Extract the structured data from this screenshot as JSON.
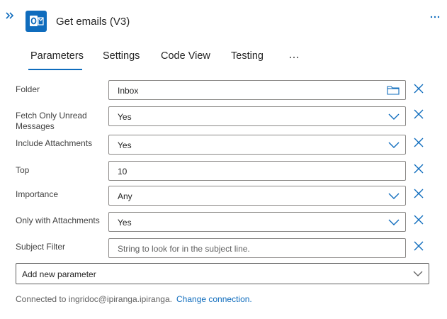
{
  "header": {
    "title": "Get emails (V3)",
    "collapse_icon": "double-chevron-right-icon",
    "action_icon": "outlook-icon",
    "more_icon": "more-horizontal-icon"
  },
  "tabs": [
    {
      "label": "Parameters",
      "selected": true
    },
    {
      "label": "Settings",
      "selected": false
    },
    {
      "label": "Code View",
      "selected": false
    },
    {
      "label": "Testing",
      "selected": false
    }
  ],
  "params": {
    "folder": {
      "label": "Folder",
      "value": "Inbox",
      "icon": "folder-icon"
    },
    "fetch_unread": {
      "label_line1": "Fetch Only Unread",
      "label_line2": "Messages",
      "value": "Yes"
    },
    "include_attachments": {
      "label": "Include Attachments",
      "value": "Yes"
    },
    "top": {
      "label": "Top",
      "value": "10"
    },
    "importance": {
      "label": "Importance",
      "value": "Any"
    },
    "only_with_attachments": {
      "label": "Only with Attachments",
      "value": "Yes"
    },
    "subject_filter": {
      "label": "Subject Filter",
      "placeholder": "String to look for in the subject line."
    }
  },
  "add_parameter": {
    "label": "Add new parameter"
  },
  "footer": {
    "connected_text": "Connected to ingridoc@ipiranga.ipiranga.",
    "change_link": "Change connection."
  },
  "colors": {
    "accent": "#0f6cbd",
    "border": "#8a8886"
  }
}
